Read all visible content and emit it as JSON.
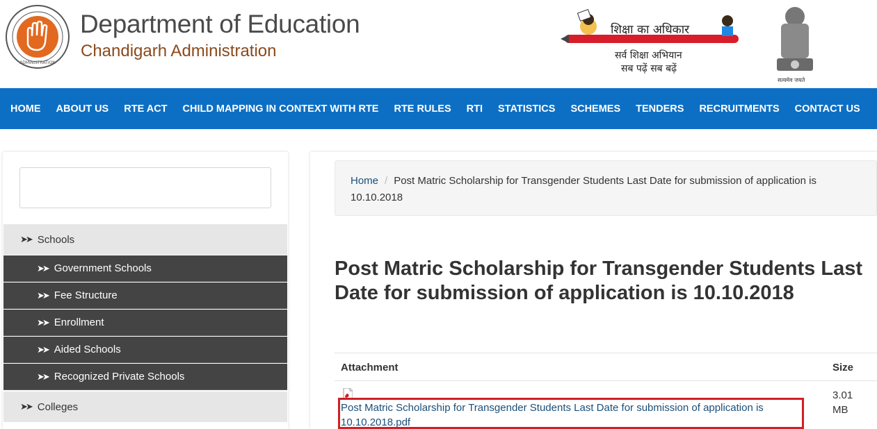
{
  "header": {
    "title": "Department of Education",
    "subtitle": "Chandigarh Administration",
    "logo_icon": "chandigarh-open-hand-logo",
    "logo_ring_text": "CHANDIGARH ADMINISTRATION",
    "logo_top_text": "सत्यमेव जयते प्रशासन",
    "rte_tagline": "शिक्षा का अधिकार",
    "rte_slogan_line1": "सर्व शिक्षा अभियान",
    "rte_slogan_line2": "सब पढ़ें सब बढ़ें",
    "emblem_icon": "national-emblem-icon",
    "emblem_caption": "सत्यमेव जयते",
    "brand_color": "#0d6fc4"
  },
  "nav": {
    "items": [
      "HOME",
      "ABOUT US",
      "RTE ACT",
      "CHILD MAPPING IN CONTEXT WITH RTE",
      "RTE RULES",
      "RTI",
      "STATISTICS",
      "SCHEMES",
      "TENDERS",
      "RECRUITMENTS",
      "CONTACT US"
    ]
  },
  "sidebar": {
    "search_placeholder": "",
    "sections": [
      {
        "label": "Schools",
        "items": [
          "Government Schools",
          "Fee Structure",
          "Enrollment",
          "Aided Schools",
          "Recognized Private Schools"
        ]
      },
      {
        "label": "Colleges",
        "items": []
      }
    ]
  },
  "breadcrumb": {
    "home": "Home",
    "separator": "/",
    "current": "Post Matric Scholarship for Transgender Students Last Date for submission of application is 10.10.2018"
  },
  "page": {
    "title": "Post Matric Scholarship for Transgender Students Last Date for submission of application is 10.10.2018"
  },
  "attachments": {
    "header_attachment": "Attachment",
    "header_size": "Size",
    "rows": [
      {
        "icon": "pdf-icon",
        "name": "Post Matric Scholarship for Transgender Students Last Date for submission of application is 10.10.2018.pdf",
        "size": "3.01 MB"
      }
    ],
    "highlight_color": "#d01f26"
  }
}
